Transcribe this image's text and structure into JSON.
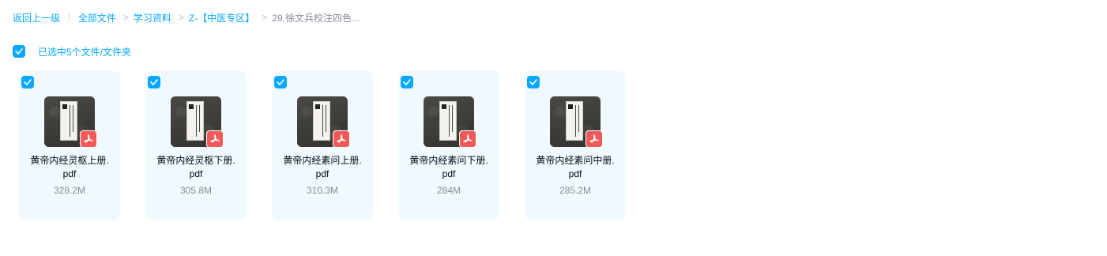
{
  "breadcrumb": {
    "back": "返回上一级",
    "separator": "|",
    "arrow": ">",
    "items": [
      "全部文件",
      "学习资料",
      "Z-【中医专区】"
    ],
    "current": "29.徐文兵校注四色..."
  },
  "selection": {
    "label": "已选中5个文件/文件夹",
    "checked": true
  },
  "files": [
    {
      "name_line1": "黄帝内经灵枢上册.",
      "name_line2": "pdf",
      "size": "328.2M",
      "type_icon": "pdf-icon",
      "checked": true
    },
    {
      "name_line1": "黄帝内经灵枢下册.",
      "name_line2": "pdf",
      "size": "305.8M",
      "type_icon": "pdf-icon",
      "checked": true
    },
    {
      "name_line1": "黄帝内经素问上册.",
      "name_line2": "pdf",
      "size": "310.3M",
      "type_icon": "pdf-icon",
      "checked": true
    },
    {
      "name_line1": "黄帝内经素问下册.",
      "name_line2": "pdf",
      "size": "284M",
      "type_icon": "pdf-icon",
      "checked": true
    },
    {
      "name_line1": "黄帝内经素问中册.",
      "name_line2": "pdf",
      "size": "285.2M",
      "type_icon": "pdf-icon",
      "checked": true
    }
  ],
  "colors": {
    "accent": "#06a7ff",
    "card_bg": "#f0f9fe",
    "pdf_badge": "#f25a5a",
    "muted_text": "#878c9c"
  }
}
